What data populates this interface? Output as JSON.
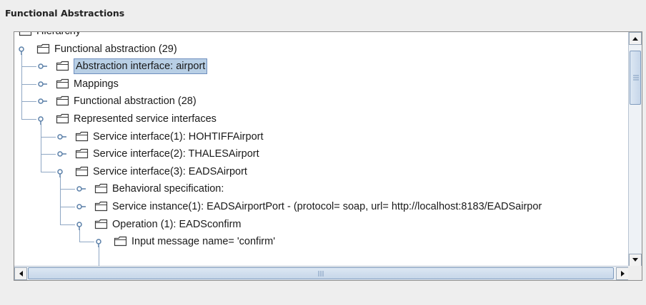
{
  "panel": {
    "title": "Functional Abstractions"
  },
  "tree": {
    "nodes": [
      {
        "label": "Hierarchy",
        "depth": 0,
        "expanded": true,
        "has_handle": false,
        "selected": false
      },
      {
        "label": "Functional abstraction (29)",
        "depth": 0,
        "expanded": true,
        "has_handle": true,
        "selected": false
      },
      {
        "label": "Abstraction interface: airport",
        "depth": 1,
        "expanded": false,
        "has_handle": true,
        "selected": true
      },
      {
        "label": "Mappings",
        "depth": 1,
        "expanded": false,
        "has_handle": true,
        "selected": false
      },
      {
        "label": "Functional abstraction (28)",
        "depth": 1,
        "expanded": false,
        "has_handle": true,
        "selected": false
      },
      {
        "label": "Represented service interfaces",
        "depth": 1,
        "expanded": true,
        "has_handle": true,
        "selected": false
      },
      {
        "label": "Service interface(1): HOHTIFFAirport",
        "depth": 2,
        "expanded": false,
        "has_handle": true,
        "selected": false
      },
      {
        "label": "Service interface(2): THALESAirport",
        "depth": 2,
        "expanded": false,
        "has_handle": true,
        "selected": false
      },
      {
        "label": "Service interface(3): EADSAirport",
        "depth": 2,
        "expanded": true,
        "has_handle": true,
        "selected": false
      },
      {
        "label": "Behavioral specification:",
        "depth": 3,
        "expanded": false,
        "has_handle": true,
        "selected": false
      },
      {
        "label": "Service instance(1): EADSAirportPort - (protocol= soap, url= http://localhost:8183/EADSairpor",
        "depth": 3,
        "expanded": false,
        "has_handle": true,
        "selected": false
      },
      {
        "label": "Operation (1): EADSconfirm",
        "depth": 3,
        "expanded": true,
        "has_handle": true,
        "selected": false
      },
      {
        "label": "Input message  name= 'confirm'",
        "depth": 4,
        "expanded": true,
        "has_handle": true,
        "selected": false
      }
    ]
  },
  "scroll": {
    "vertical_position": 0.08,
    "horizontal_position": 0.0
  },
  "colors": {
    "selection": "#b8cfe5",
    "tree_line": "#8fa7c4",
    "folder_outline": "#3c3c3c",
    "thumb": "#c6d6e9"
  }
}
